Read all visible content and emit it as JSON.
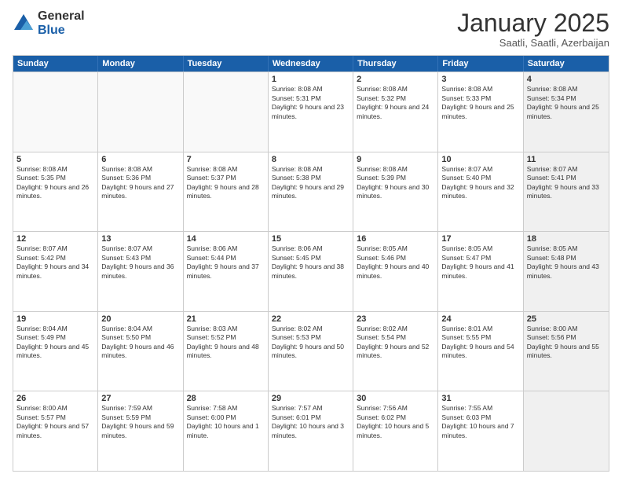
{
  "logo": {
    "general": "General",
    "blue": "Blue"
  },
  "header": {
    "month": "January 2025",
    "location": "Saatli, Saatli, Azerbaijan"
  },
  "days": [
    "Sunday",
    "Monday",
    "Tuesday",
    "Wednesday",
    "Thursday",
    "Friday",
    "Saturday"
  ],
  "weeks": [
    [
      {
        "num": "",
        "text": "",
        "empty": true
      },
      {
        "num": "",
        "text": "",
        "empty": true
      },
      {
        "num": "",
        "text": "",
        "empty": true
      },
      {
        "num": "1",
        "text": "Sunrise: 8:08 AM\nSunset: 5:31 PM\nDaylight: 9 hours and 23 minutes.",
        "empty": false
      },
      {
        "num": "2",
        "text": "Sunrise: 8:08 AM\nSunset: 5:32 PM\nDaylight: 9 hours and 24 minutes.",
        "empty": false
      },
      {
        "num": "3",
        "text": "Sunrise: 8:08 AM\nSunset: 5:33 PM\nDaylight: 9 hours and 25 minutes.",
        "empty": false
      },
      {
        "num": "4",
        "text": "Sunrise: 8:08 AM\nSunset: 5:34 PM\nDaylight: 9 hours and 25 minutes.",
        "empty": false,
        "shaded": true
      }
    ],
    [
      {
        "num": "5",
        "text": "Sunrise: 8:08 AM\nSunset: 5:35 PM\nDaylight: 9 hours and 26 minutes.",
        "empty": false
      },
      {
        "num": "6",
        "text": "Sunrise: 8:08 AM\nSunset: 5:36 PM\nDaylight: 9 hours and 27 minutes.",
        "empty": false
      },
      {
        "num": "7",
        "text": "Sunrise: 8:08 AM\nSunset: 5:37 PM\nDaylight: 9 hours and 28 minutes.",
        "empty": false
      },
      {
        "num": "8",
        "text": "Sunrise: 8:08 AM\nSunset: 5:38 PM\nDaylight: 9 hours and 29 minutes.",
        "empty": false
      },
      {
        "num": "9",
        "text": "Sunrise: 8:08 AM\nSunset: 5:39 PM\nDaylight: 9 hours and 30 minutes.",
        "empty": false
      },
      {
        "num": "10",
        "text": "Sunrise: 8:07 AM\nSunset: 5:40 PM\nDaylight: 9 hours and 32 minutes.",
        "empty": false
      },
      {
        "num": "11",
        "text": "Sunrise: 8:07 AM\nSunset: 5:41 PM\nDaylight: 9 hours and 33 minutes.",
        "empty": false,
        "shaded": true
      }
    ],
    [
      {
        "num": "12",
        "text": "Sunrise: 8:07 AM\nSunset: 5:42 PM\nDaylight: 9 hours and 34 minutes.",
        "empty": false
      },
      {
        "num": "13",
        "text": "Sunrise: 8:07 AM\nSunset: 5:43 PM\nDaylight: 9 hours and 36 minutes.",
        "empty": false
      },
      {
        "num": "14",
        "text": "Sunrise: 8:06 AM\nSunset: 5:44 PM\nDaylight: 9 hours and 37 minutes.",
        "empty": false
      },
      {
        "num": "15",
        "text": "Sunrise: 8:06 AM\nSunset: 5:45 PM\nDaylight: 9 hours and 38 minutes.",
        "empty": false
      },
      {
        "num": "16",
        "text": "Sunrise: 8:05 AM\nSunset: 5:46 PM\nDaylight: 9 hours and 40 minutes.",
        "empty": false
      },
      {
        "num": "17",
        "text": "Sunrise: 8:05 AM\nSunset: 5:47 PM\nDaylight: 9 hours and 41 minutes.",
        "empty": false
      },
      {
        "num": "18",
        "text": "Sunrise: 8:05 AM\nSunset: 5:48 PM\nDaylight: 9 hours and 43 minutes.",
        "empty": false,
        "shaded": true
      }
    ],
    [
      {
        "num": "19",
        "text": "Sunrise: 8:04 AM\nSunset: 5:49 PM\nDaylight: 9 hours and 45 minutes.",
        "empty": false
      },
      {
        "num": "20",
        "text": "Sunrise: 8:04 AM\nSunset: 5:50 PM\nDaylight: 9 hours and 46 minutes.",
        "empty": false
      },
      {
        "num": "21",
        "text": "Sunrise: 8:03 AM\nSunset: 5:52 PM\nDaylight: 9 hours and 48 minutes.",
        "empty": false
      },
      {
        "num": "22",
        "text": "Sunrise: 8:02 AM\nSunset: 5:53 PM\nDaylight: 9 hours and 50 minutes.",
        "empty": false
      },
      {
        "num": "23",
        "text": "Sunrise: 8:02 AM\nSunset: 5:54 PM\nDaylight: 9 hours and 52 minutes.",
        "empty": false
      },
      {
        "num": "24",
        "text": "Sunrise: 8:01 AM\nSunset: 5:55 PM\nDaylight: 9 hours and 54 minutes.",
        "empty": false
      },
      {
        "num": "25",
        "text": "Sunrise: 8:00 AM\nSunset: 5:56 PM\nDaylight: 9 hours and 55 minutes.",
        "empty": false,
        "shaded": true
      }
    ],
    [
      {
        "num": "26",
        "text": "Sunrise: 8:00 AM\nSunset: 5:57 PM\nDaylight: 9 hours and 57 minutes.",
        "empty": false
      },
      {
        "num": "27",
        "text": "Sunrise: 7:59 AM\nSunset: 5:59 PM\nDaylight: 9 hours and 59 minutes.",
        "empty": false
      },
      {
        "num": "28",
        "text": "Sunrise: 7:58 AM\nSunset: 6:00 PM\nDaylight: 10 hours and 1 minute.",
        "empty": false
      },
      {
        "num": "29",
        "text": "Sunrise: 7:57 AM\nSunset: 6:01 PM\nDaylight: 10 hours and 3 minutes.",
        "empty": false
      },
      {
        "num": "30",
        "text": "Sunrise: 7:56 AM\nSunset: 6:02 PM\nDaylight: 10 hours and 5 minutes.",
        "empty": false
      },
      {
        "num": "31",
        "text": "Sunrise: 7:55 AM\nSunset: 6:03 PM\nDaylight: 10 hours and 7 minutes.",
        "empty": false
      },
      {
        "num": "",
        "text": "",
        "empty": true,
        "shaded": true
      }
    ]
  ]
}
